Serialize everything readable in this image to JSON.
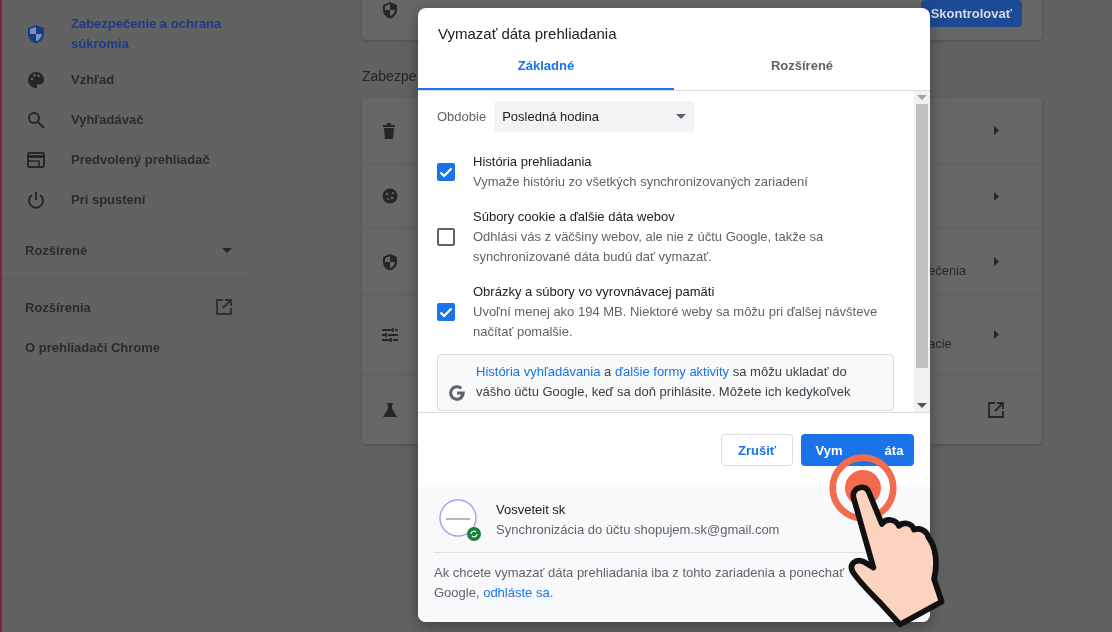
{
  "sidebar": {
    "items": [
      {
        "label": "Zabezpečenie a ochrana súkromia",
        "selected": true
      },
      {
        "label": "Vzhľad",
        "selected": false
      },
      {
        "label": "Vyhľadávač",
        "selected": false
      },
      {
        "label": "Predvolený prehliadač",
        "selected": false
      },
      {
        "label": "Pri spustení",
        "selected": false
      }
    ],
    "advanced": {
      "label": "Rozšírené",
      "expanded": false
    },
    "links": [
      {
        "label": "Rozšírenia",
        "kind": "external"
      },
      {
        "label": "O prehliadači Chrome",
        "kind": "plain"
      }
    ]
  },
  "main": {
    "top_button": "Skontrolovať",
    "section_heading": "Zabezpe",
    "rows": [
      {
        "kind": "arrow"
      },
      {
        "kind": "arrow"
      },
      {
        "kind": "arrow",
        "fragment": "ečenia"
      },
      {
        "kind": "arrow",
        "fragment": "acie"
      },
      {
        "kind": "external"
      }
    ]
  },
  "dialog": {
    "title": "Vymazať dáta prehliadania",
    "tabs": [
      {
        "label": "Základné",
        "selected": true
      },
      {
        "label": "Rozšírené",
        "selected": false
      }
    ],
    "period": {
      "label": "Obdobie",
      "value": "Posledná hodina"
    },
    "options": [
      {
        "title": "História prehliadania",
        "description": "Vymaže históriu zo všetkých synchronizovaných zariadení",
        "checked": true
      },
      {
        "title": "Súbory cookie a ďalšie dáta webov",
        "description": "Odhlási vás z väčšiny webov, ale nie z účtu Google, takže sa synchronizované dáta budú dať vymazať.",
        "checked": false
      },
      {
        "title": "Obrázky a súbory vo vyrovnávacej pamäti",
        "description": "Uvoľní menej ako 194 MB. Niektoré weby sa môžu pri ďalšej návšteve načítať pomalšie.",
        "checked": true
      }
    ],
    "info": [
      {
        "text": "História vyhľadávania",
        "link": true
      },
      {
        "text": " a ",
        "link": false
      },
      {
        "text": "ďalšie formy aktivity",
        "link": true
      },
      {
        "text": " sa môžu ukladať do vášho účtu Google, keď sa doň prihlásite. Môžete ich kedykoľvek",
        "link": false
      }
    ],
    "buttons": {
      "cancel": "Zrušiť",
      "confirm": [
        "Vym",
        "áta"
      ]
    },
    "account": {
      "name": "Vosveteit sk",
      "sync": "Synchronizácia do účtu shopujem.sk@gmail.com"
    },
    "note": [
      {
        "text": "Ak chcete vymazať dáta prehliadania iba z tohto zariadenia a ponechať",
        "link": false
      },
      {
        "text": "Google, ",
        "link": false
      },
      {
        "text": "odhláste sa",
        "link": true
      },
      {
        "text": ".",
        "link": false
      }
    ]
  }
}
